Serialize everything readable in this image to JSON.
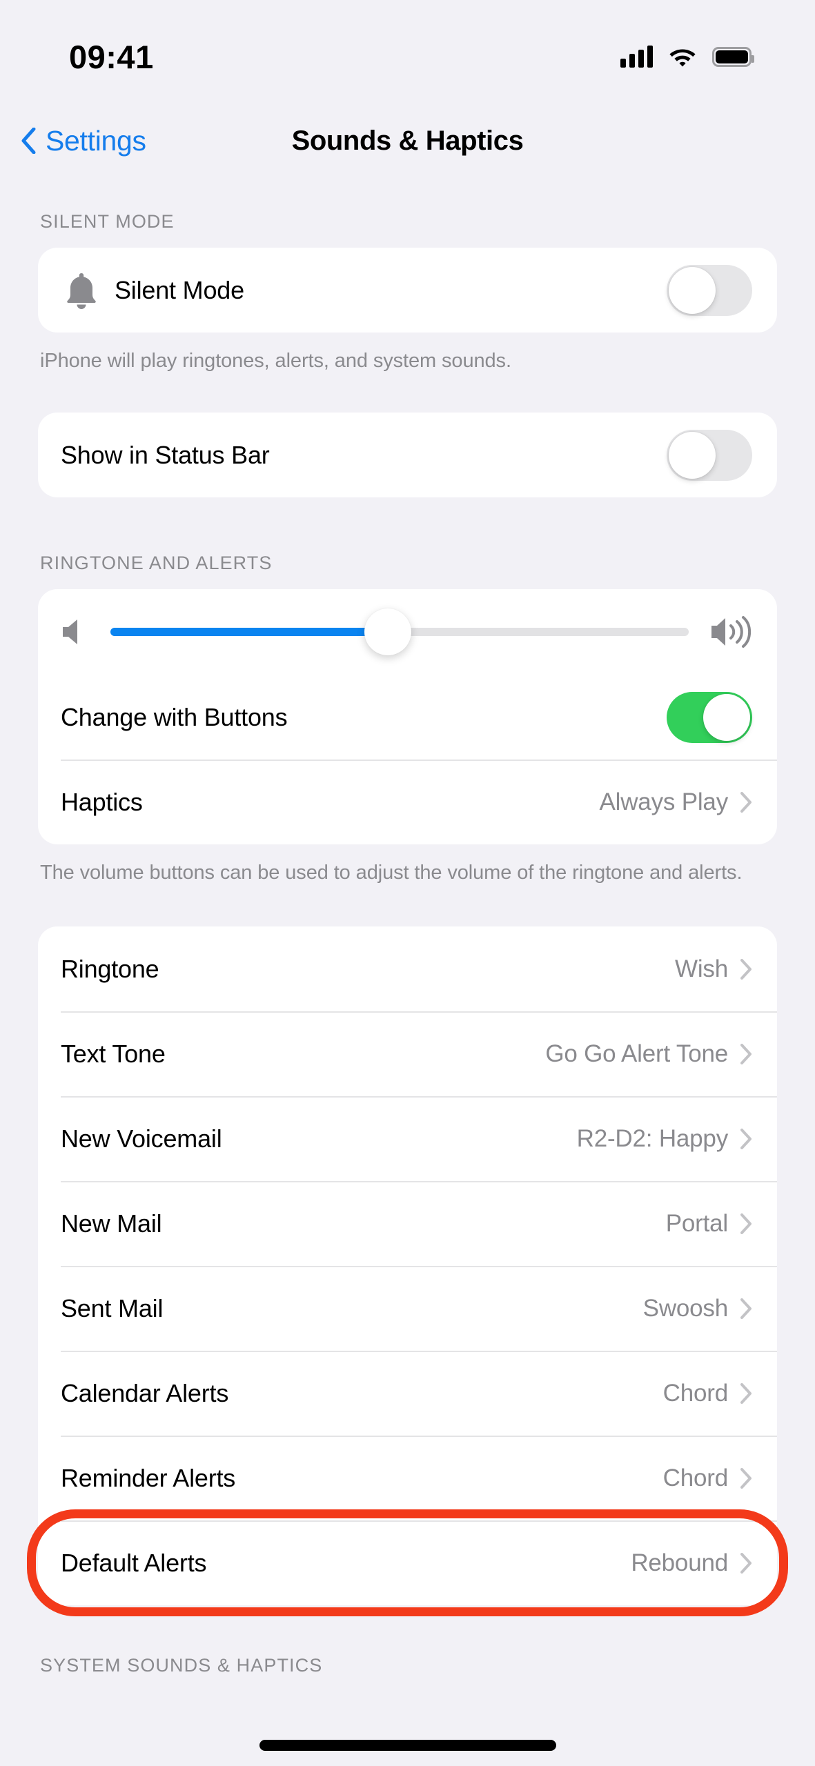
{
  "status_bar": {
    "time": "09:41",
    "cellular_icon": "cellular-signal-icon",
    "wifi_icon": "wifi-icon",
    "battery_icon": "battery-full-icon"
  },
  "nav": {
    "back_label": "Settings",
    "back_icon": "chevron-left-icon",
    "title": "Sounds & Haptics"
  },
  "colors": {
    "accent_blue": "#157DEC",
    "slider_blue": "#0A84F0",
    "toggle_on_green": "#32CF5A",
    "toggle_off_gray": "#E6E6E8",
    "annotation_red": "#F33A1A",
    "page_background": "#F2F1F6",
    "card_background": "#FFFFFF",
    "secondary_text": "#8A8A8E"
  },
  "sections": {
    "silent_mode": {
      "header": "SILENT MODE",
      "row_label": "Silent Mode",
      "row_icon": "bell-icon",
      "toggle_state": "off",
      "footer": "iPhone will play ringtones, alerts, and system sounds."
    },
    "status_bar_card": {
      "row_label": "Show in Status Bar",
      "toggle_state": "off"
    },
    "ringtone_alerts": {
      "header": "RINGTONE AND ALERTS",
      "slider": {
        "value_percent": 48,
        "left_icon": "speaker-low-icon",
        "right_icon": "speaker-high-icon"
      },
      "rows": [
        {
          "label": "Change with Buttons",
          "type": "toggle",
          "toggle_state": "on"
        },
        {
          "label": "Haptics",
          "type": "value",
          "value": "Always Play",
          "chevron": "chevron-right-icon"
        }
      ],
      "footer": "The volume buttons can be used to adjust the volume of the ringtone and alerts."
    },
    "tones": {
      "rows": [
        {
          "label": "Ringtone",
          "value": "Wish",
          "chevron": "chevron-right-icon"
        },
        {
          "label": "Text Tone",
          "value": "Go Go Alert Tone",
          "chevron": "chevron-right-icon"
        },
        {
          "label": "New Voicemail",
          "value": "R2-D2: Happy",
          "chevron": "chevron-right-icon"
        },
        {
          "label": "New Mail",
          "value": "Portal",
          "chevron": "chevron-right-icon"
        },
        {
          "label": "Sent Mail",
          "value": "Swoosh",
          "chevron": "chevron-right-icon"
        },
        {
          "label": "Calendar Alerts",
          "value": "Chord",
          "chevron": "chevron-right-icon"
        },
        {
          "label": "Reminder Alerts",
          "value": "Chord",
          "chevron": "chevron-right-icon"
        },
        {
          "label": "Default Alerts",
          "value": "Rebound",
          "chevron": "chevron-right-icon",
          "highlighted": true
        }
      ]
    },
    "system_sounds": {
      "header": "SYSTEM SOUNDS & HAPTICS"
    }
  }
}
